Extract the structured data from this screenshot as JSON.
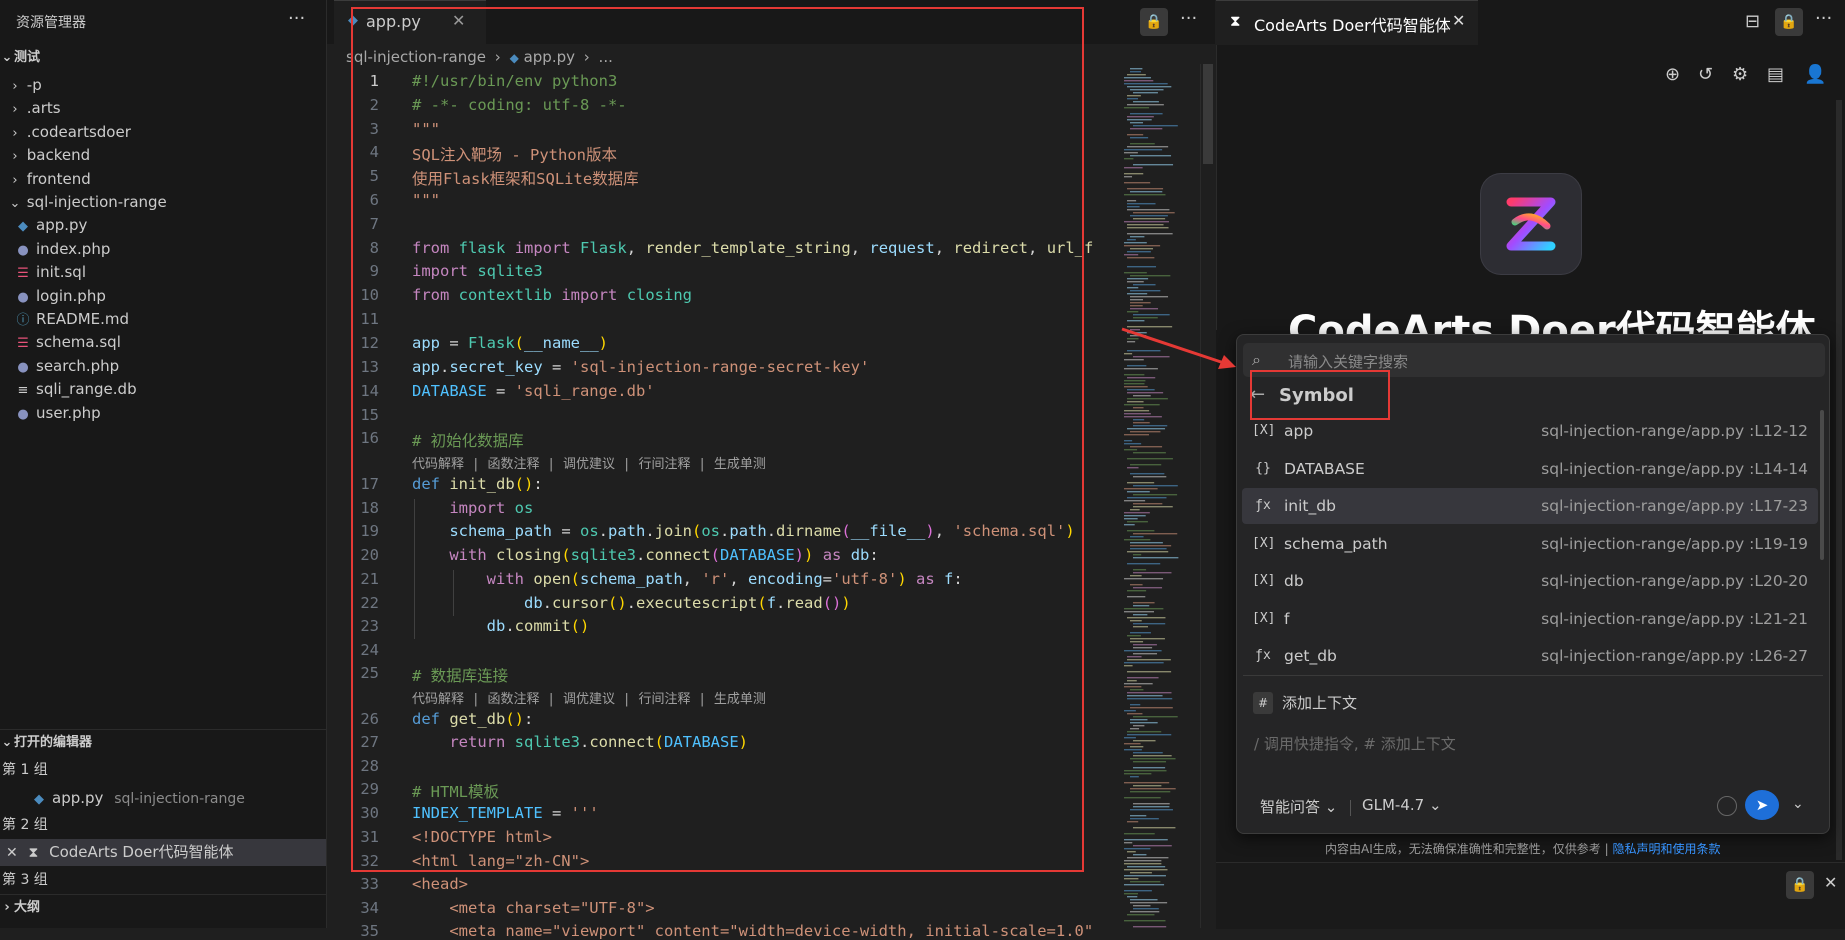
{
  "explorer": {
    "title": "资源管理器",
    "more": "···",
    "root": "测试",
    "items": [
      {
        "label": "-p",
        "type": "folder"
      },
      {
        "label": ".arts",
        "type": "folder"
      },
      {
        "label": ".codeartsdoer",
        "type": "folder"
      },
      {
        "label": "backend",
        "type": "folder"
      },
      {
        "label": "frontend",
        "type": "folder"
      },
      {
        "label": "sql-injection-range",
        "type": "folder-open"
      },
      {
        "label": "app.py",
        "type": "python"
      },
      {
        "label": "index.php",
        "type": "php"
      },
      {
        "label": "init.sql",
        "type": "sql"
      },
      {
        "label": "login.php",
        "type": "php"
      },
      {
        "label": "README.md",
        "type": "info"
      },
      {
        "label": "schema.sql",
        "type": "sql"
      },
      {
        "label": "search.php",
        "type": "php"
      },
      {
        "label": "sqli_range.db",
        "type": "db"
      },
      {
        "label": "user.php",
        "type": "php"
      }
    ],
    "open_editors": {
      "title": "打开的编辑器",
      "group1": "第 1 组",
      "group1_file": "app.py",
      "group1_path": "sql-injection-range",
      "group2": "第 2 组",
      "group2_item": "CodeArts Doer代码智能体",
      "group3": "第 3 组"
    },
    "outline": "大纲"
  },
  "editor": {
    "tab_label": "app.py",
    "breadcrumb": [
      "sql-injection-range",
      "app.py",
      "..."
    ],
    "lens_text": "代码解释 | 函数注释 | 调优建议 | 行间注释 | 生成单测",
    "line_numbers": [
      "1",
      "2",
      "3",
      "4",
      "5",
      "6",
      "7",
      "8",
      "9",
      "10",
      "11",
      "12",
      "13",
      "14",
      "15",
      "16",
      "17",
      "18",
      "19",
      "20",
      "21",
      "22",
      "23",
      "24",
      "25",
      "26",
      "27",
      "28",
      "29",
      "30",
      "31",
      "32",
      "33",
      "34",
      "35"
    ],
    "code_text": {
      "l1": "#!/usr/bin/env python3",
      "l2": "# -*- coding: utf-8 -*-",
      "l3": "\"\"\"",
      "l4": "SQL注入靶场 - Python版本",
      "l5": "使用Flask框架和SQLite数据库",
      "l6": "\"\"\"",
      "l16": "# 初始化数据库",
      "l25": "# 数据库连接",
      "l29": "# HTML模板"
    }
  },
  "panel": {
    "tab_label": "CodeArts Doer代码智能体",
    "title": "CodeArts Doer代码智能体",
    "search_placeholder": "请输入关键字搜索",
    "symbol_header": "Symbol",
    "symbols": [
      {
        "icon": "[X]",
        "name": "app",
        "path": "sql-injection-range/app.py :L12-12"
      },
      {
        "icon": "{}",
        "name": "DATABASE",
        "path": "sql-injection-range/app.py :L14-14"
      },
      {
        "icon": "ƒx",
        "name": "init_db",
        "path": "sql-injection-range/app.py :L17-23"
      },
      {
        "icon": "[X]",
        "name": "schema_path",
        "path": "sql-injection-range/app.py :L19-19"
      },
      {
        "icon": "[X]",
        "name": "db",
        "path": "sql-injection-range/app.py :L20-20"
      },
      {
        "icon": "[X]",
        "name": "f",
        "path": "sql-injection-range/app.py :L21-21"
      },
      {
        "icon": "ƒx",
        "name": "get_db",
        "path": "sql-injection-range/app.py :L26-27"
      }
    ],
    "add_context_tag": "#",
    "add_context": "添加上下文",
    "input_hint": "/ 调用快捷指令, # 添加上下文",
    "mode": "智能问答",
    "model": "GLM-4.7",
    "disclaimer": "内容由AI生成，无法确保准确性和完整性，仅供参考 | ",
    "disclaimer_link": "隐私声明和使用条款"
  },
  "colors": {
    "annotation_red": "#e53935",
    "send_blue": "#1e6fd9",
    "keyword_purple": "#c586c0",
    "string_orange": "#ce9178",
    "comment_green": "#6a9955"
  }
}
